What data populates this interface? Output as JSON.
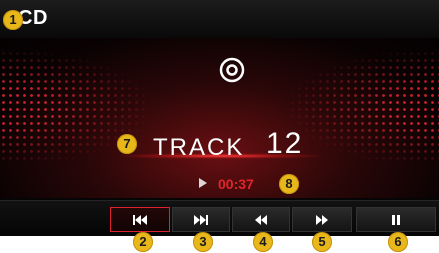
{
  "header": {
    "title": "CD"
  },
  "track": {
    "label": "TRACK",
    "number": "12"
  },
  "playback": {
    "elapsed": "00:37"
  },
  "controls": [
    {
      "name": "previous-track",
      "icon": "skip-previous-icon"
    },
    {
      "name": "next-track",
      "icon": "skip-next-icon"
    },
    {
      "name": "rewind",
      "icon": "rewind-icon"
    },
    {
      "name": "fast-forward",
      "icon": "fast-forward-icon"
    },
    {
      "name": "pause",
      "icon": "pause-icon"
    }
  ],
  "callouts": {
    "n1": "1",
    "n2": "2",
    "n3": "3",
    "n4": "4",
    "n5": "5",
    "n6": "6",
    "n7": "7",
    "n8": "8"
  },
  "colors": {
    "background": "#050505",
    "accent_red": "#e3242b",
    "callout_yellow": "#e8b81b",
    "text_white": "#ffffff"
  }
}
